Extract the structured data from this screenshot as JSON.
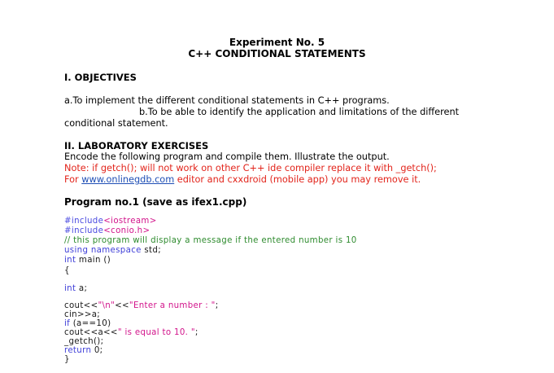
{
  "header": {
    "title": "Experiment No. 5",
    "subtitle": "C++ CONDITIONAL STATEMENTS"
  },
  "objectives": {
    "heading": "I. OBJECTIVES",
    "item_a": "a.To implement the different conditional statements in C++ programs.",
    "item_b_line1": "b.To be able to identify the application and limitations of the different",
    "item_b_line2": "conditional statement."
  },
  "lab": {
    "heading": "II. LABORATORY EXERCISES",
    "intro": "Encode the following program and compile them. Illustrate the output.",
    "note_line1": "Note: if getch(); will not work on other C++ ide compiler replace it with _getch();",
    "note_for": "For ",
    "note_link": "www.onlinegdb.com",
    "note_rest": " editor and cxxdroid (mobile app) you may remove it."
  },
  "program": {
    "title": "Program no.1 (save as ifex1.cpp)",
    "include_kw1": "#include",
    "include_arg1": "<iostream>",
    "include_kw2": "#include",
    "include_arg2": "<conio.h>",
    "comment": "// this program will display a message if the entered number is 10",
    "using_kw": "using namespace",
    "using_rest": " std;",
    "int_kw": "int",
    "main_rest": " main ()",
    "open_brace": "{",
    "decl_kw": "int",
    "decl_rest": " a;",
    "cout1_a": "cout<<",
    "cout1_b": "\"\\n\"",
    "cout1_c": "<<",
    "cout1_d": "\"Enter a number : \"",
    "cout1_e": ";",
    "cin": "cin>>a;",
    "if_kw": "if",
    "if_rest": " (a==10)",
    "cout2_a": "cout<<a<<",
    "cout2_b": "\" is equal to 10. \"",
    "cout2_c": ";",
    "getch": "_getch();",
    "return_kw": "return",
    "return_rest": " 0;",
    "close_brace": "}"
  }
}
